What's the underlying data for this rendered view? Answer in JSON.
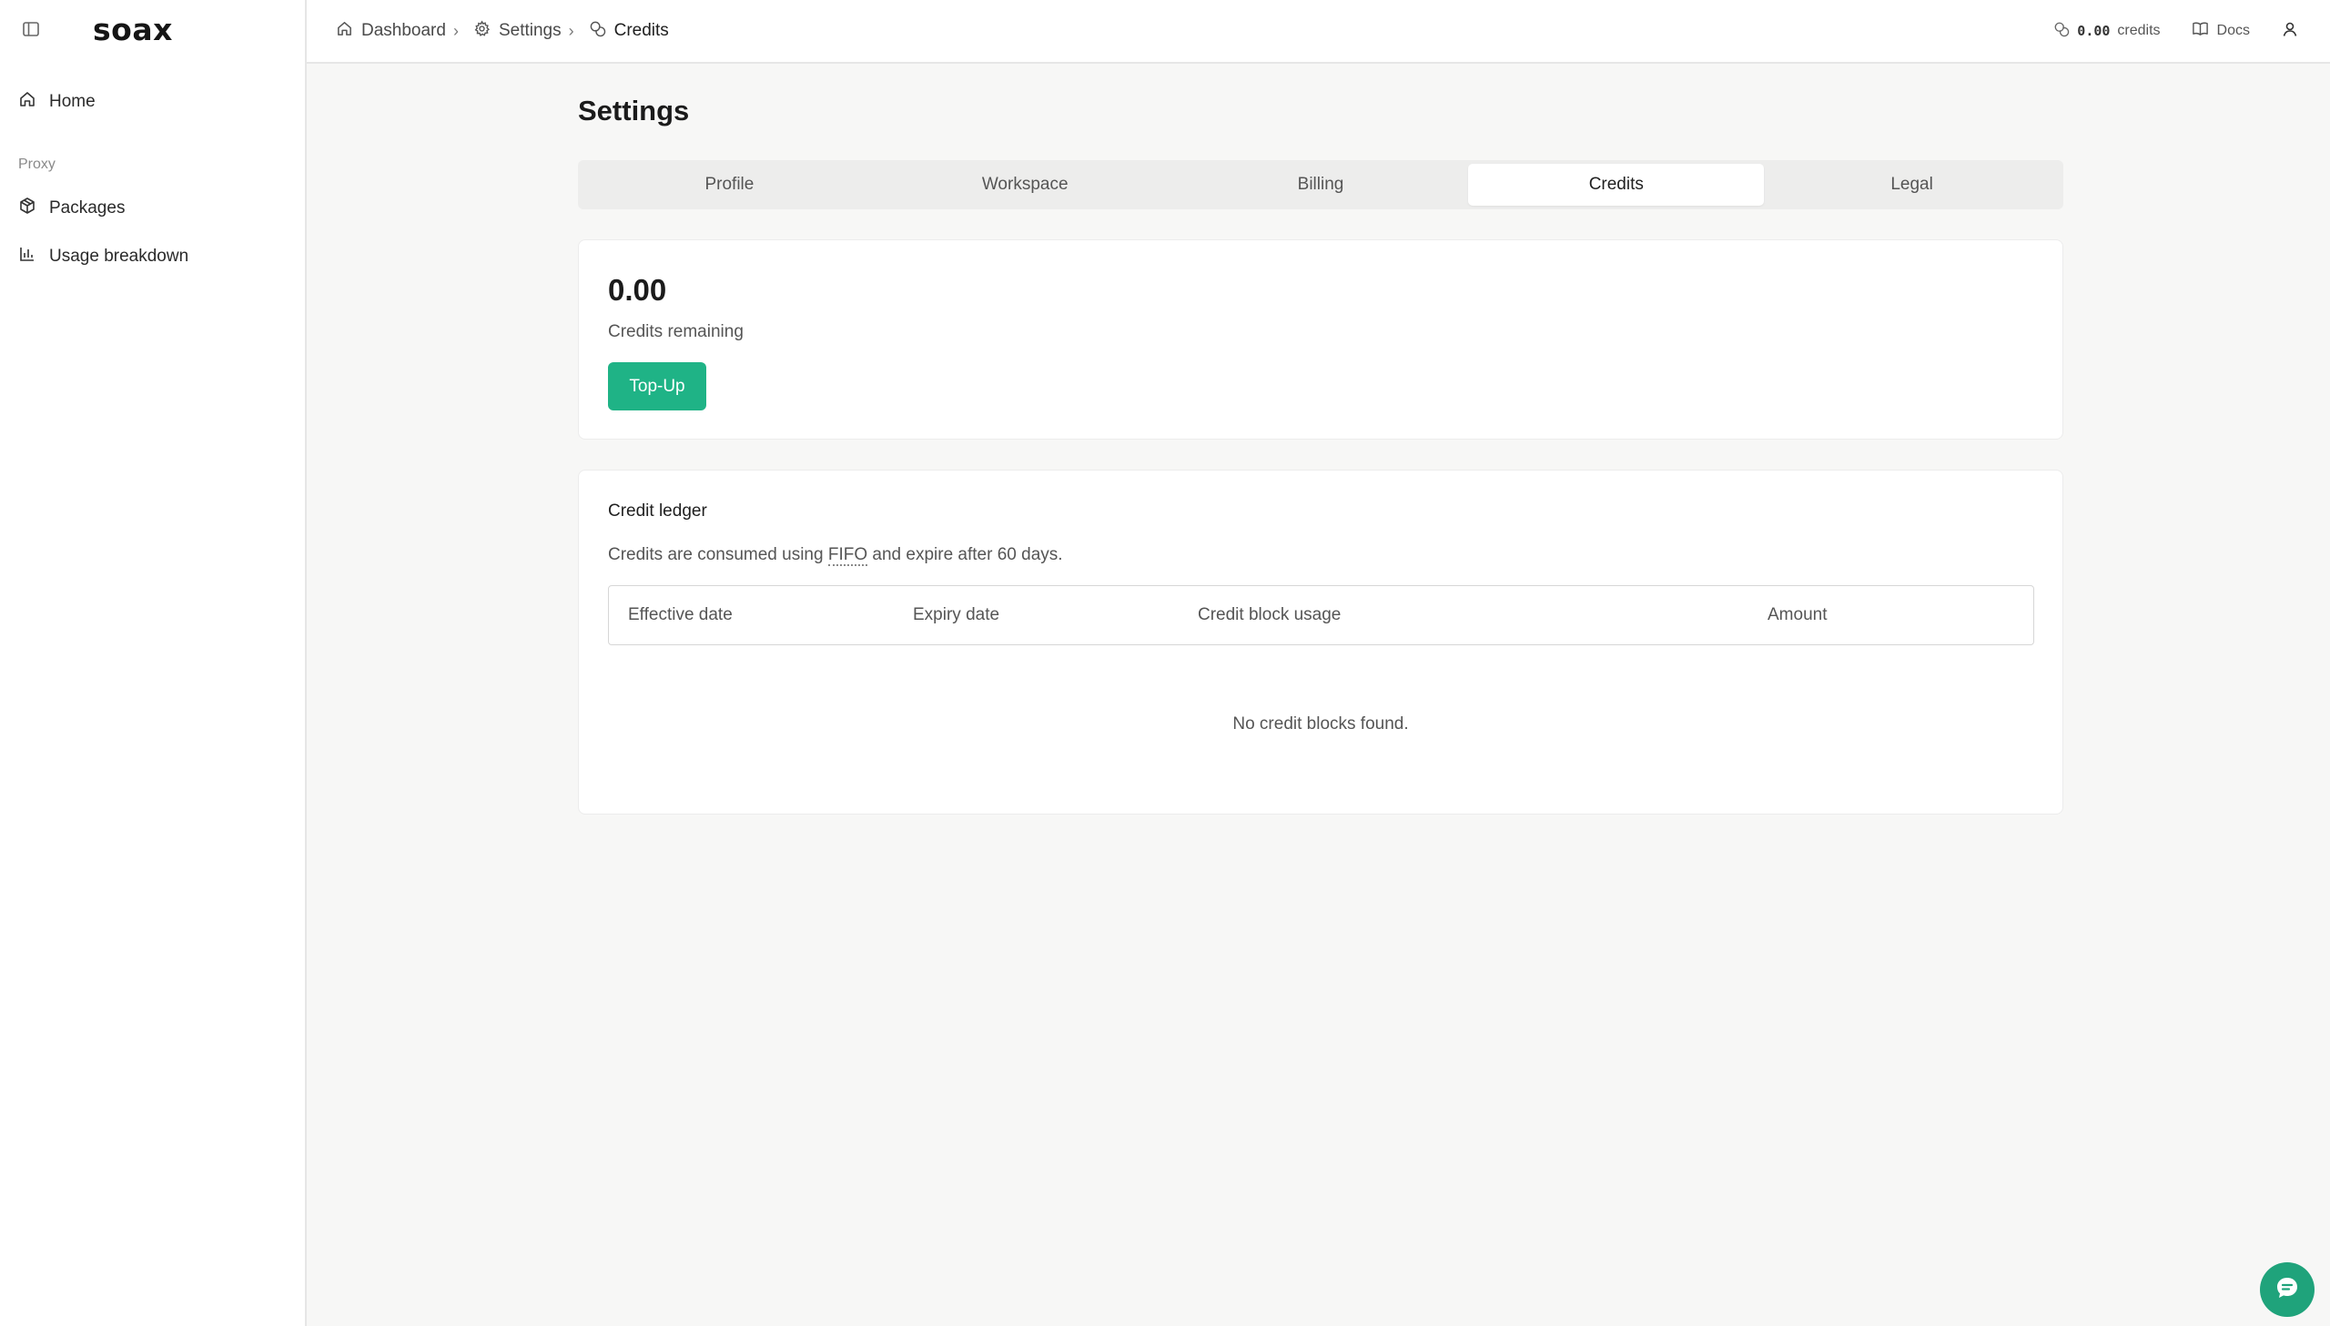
{
  "brand": {
    "logo": "soax",
    "accent_color": "#1fb386"
  },
  "sidebar": {
    "toggle_icon": "sidebar-toggle-icon",
    "items": [
      {
        "label": "Home",
        "icon": "home-icon"
      },
      {
        "section": "Proxy"
      },
      {
        "label": "Packages",
        "icon": "package-icon"
      },
      {
        "label": "Usage breakdown",
        "icon": "bar-chart-icon"
      }
    ]
  },
  "header": {
    "breadcrumb": [
      {
        "label": "Dashboard",
        "icon": "home-icon"
      },
      {
        "label": "Settings",
        "icon": "gear-icon"
      },
      {
        "label": "Credits",
        "icon": "coins-icon"
      }
    ],
    "credits": {
      "value": "0.00",
      "unit": "credits"
    },
    "docs_label": "Docs"
  },
  "main": {
    "title": "Settings",
    "tabs": [
      {
        "label": "Profile",
        "active": false
      },
      {
        "label": "Workspace",
        "active": false
      },
      {
        "label": "Billing",
        "active": false
      },
      {
        "label": "Credits",
        "active": true
      },
      {
        "label": "Legal",
        "active": false
      }
    ],
    "balance": {
      "value": "0.00",
      "label": "Credits remaining",
      "button_label": "Top-Up"
    },
    "ledger": {
      "title": "Credit ledger",
      "desc_before": "Credits are consumed using ",
      "desc_abbr": "FIFO",
      "desc_after": " and expire after 60 days.",
      "columns": [
        "Effective date",
        "Expiry date",
        "Credit block usage",
        "Amount"
      ],
      "rows": [],
      "empty_text": "No credit blocks found."
    }
  }
}
